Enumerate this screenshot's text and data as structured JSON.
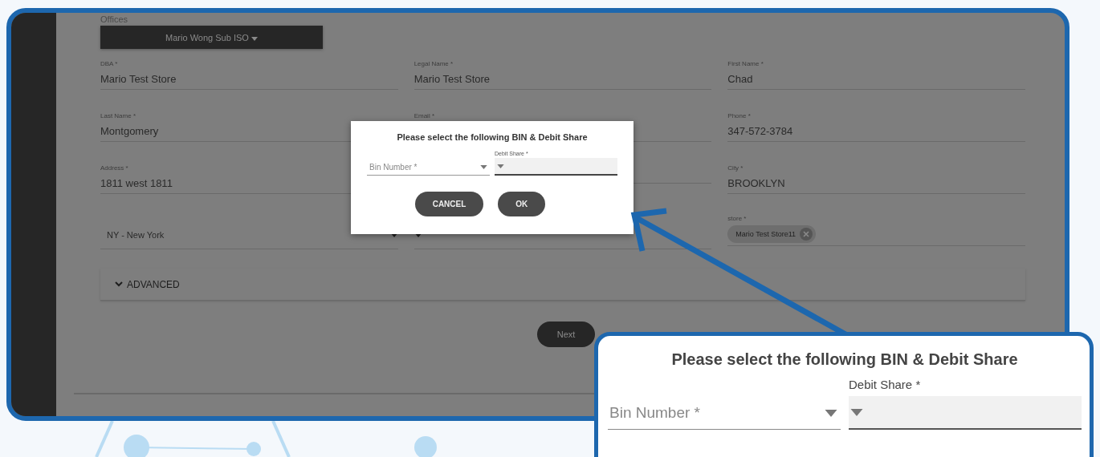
{
  "offices": {
    "label": "Offices",
    "value": "Mario Wong Sub ISO"
  },
  "fields": [
    {
      "kind": "text",
      "label": "DBA *",
      "value": "Mario Test Store"
    },
    {
      "kind": "text",
      "label": "Legal Name *",
      "value": "Mario Test Store"
    },
    {
      "kind": "text",
      "label": "First Name *",
      "value": "Chad"
    },
    {
      "kind": "text",
      "label": "Last Name *",
      "value": "Montgomery"
    },
    {
      "kind": "text",
      "label": "Email *"
    },
    {
      "kind": "text",
      "label": "Phone *",
      "value": "347-572-3784"
    },
    {
      "kind": "text",
      "label": "Address *",
      "value": "1811 west 1811"
    },
    {
      "kind": "text"
    },
    {
      "kind": "text",
      "label": "City *",
      "value": "BROOKLYN"
    },
    {
      "kind": "select",
      "value": "NY - New York"
    },
    {
      "kind": "select"
    },
    {
      "kind": "chips",
      "label": "store *",
      "chips": [
        "Mario Test Store11"
      ]
    }
  ],
  "advanced": {
    "label": "ADVANCED",
    "expanded": false
  },
  "next_button": "Next",
  "dialog": {
    "title": "Please select the following BIN & Debit Share",
    "fields": [
      {
        "label": "Bin Number *",
        "focused": false
      },
      {
        "label": "Debit Share *",
        "focused": true
      }
    ],
    "buttons": [
      "CANCEL",
      "OK"
    ]
  },
  "callout": {
    "title": "Please select the following BIN & Debit Share",
    "fields": [
      {
        "label": "Bin Number *",
        "focused": false
      },
      {
        "label": "Debit Share *",
        "focused": true
      }
    ]
  }
}
